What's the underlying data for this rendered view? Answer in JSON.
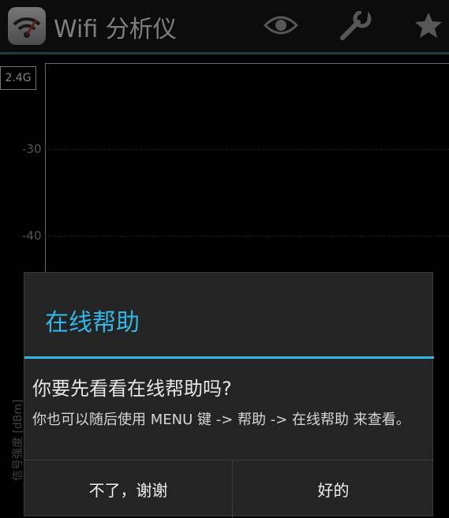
{
  "actionbar": {
    "title": "Wifi 分析仪",
    "icons": [
      "eye-icon",
      "wrench-icon",
      "star-icon"
    ],
    "accent_line": "#2b6f86"
  },
  "chart": {
    "band_label": "2.4G",
    "ylabel": "信号强度 [dBm]",
    "ticks": [
      "-30",
      "-40"
    ]
  },
  "dialog": {
    "title": "在线帮助",
    "question": "你要先看看在线帮助吗?",
    "message": "你也可以随后使用 MENU 键 -> 帮助 -> 在线帮助 来查看。",
    "cancel_label": "不了，谢谢",
    "ok_label": "好的",
    "accent": "#33b5e5"
  }
}
